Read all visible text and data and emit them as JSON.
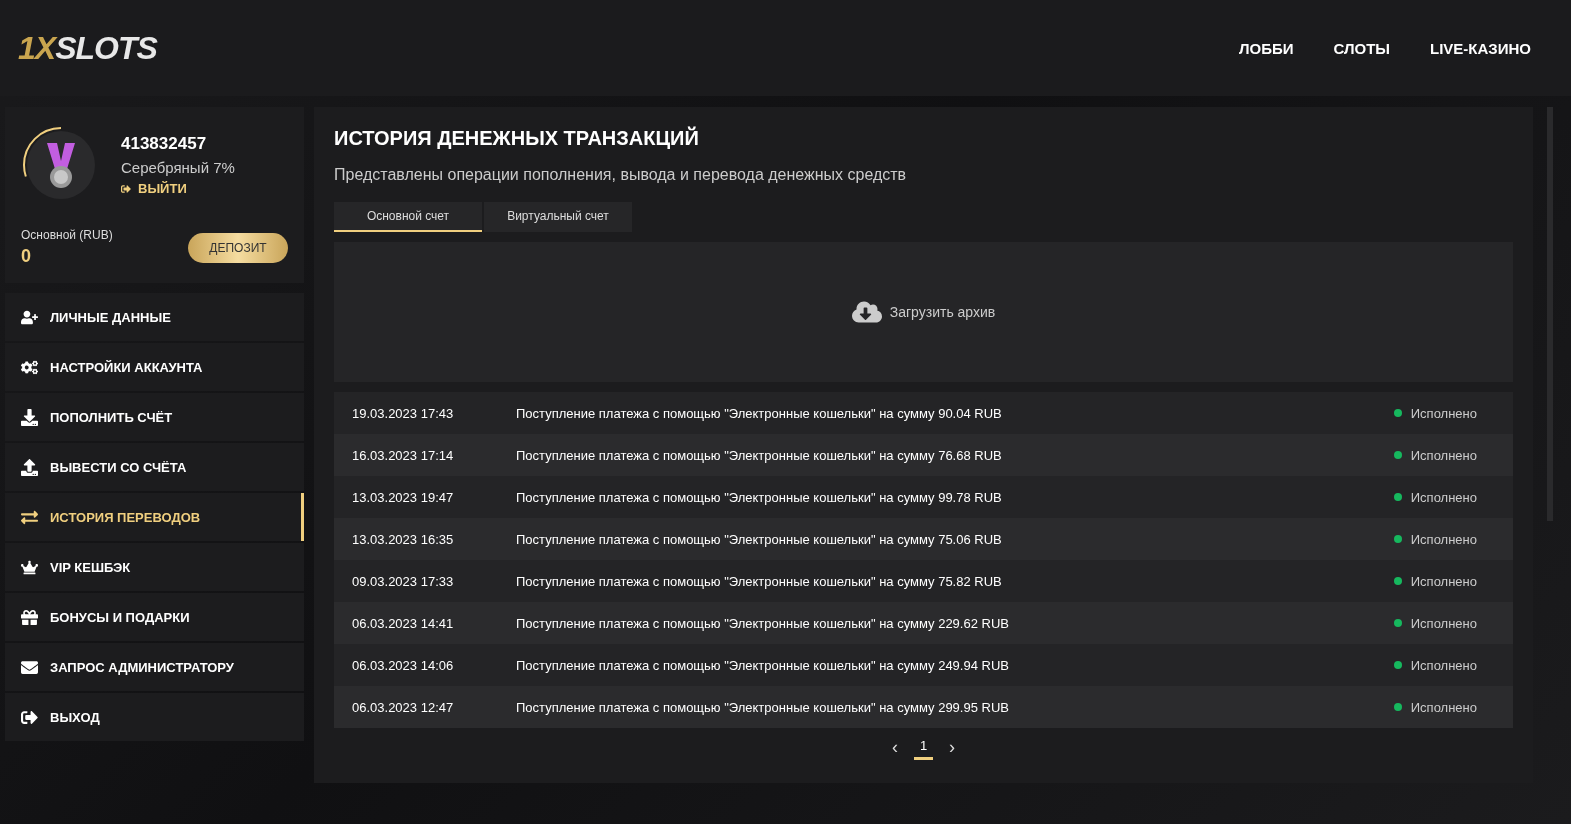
{
  "header": {
    "logo": {
      "accent": "1X",
      "rest": "SLOTS"
    },
    "nav": [
      {
        "label": "ЛОББИ",
        "selected": false
      },
      {
        "label": "СЛОТЫ",
        "selected": false
      },
      {
        "label": "LIVE-КАЗИНО",
        "selected": false
      }
    ]
  },
  "profile": {
    "id": "413832457",
    "status": "Серебряный 7%",
    "level": 0.3,
    "logout": "ВЫЙТИ",
    "balance_label": "Основной (RUB)",
    "balance": "0",
    "deposit": "ДЕПОЗИТ"
  },
  "menu": [
    {
      "kind": "user",
      "label": "ЛИЧНЫЕ ДАННЫЕ",
      "selected": false
    },
    {
      "kind": "gears",
      "label": "НАСТРОЙКИ АККАУНТА",
      "selected": false
    },
    {
      "kind": "download",
      "label": "ПОПОЛНИТЬ СЧЁТ",
      "selected": false
    },
    {
      "kind": "upload",
      "label": "ВЫВЕСТИ СО СЧЁТА",
      "selected": false
    },
    {
      "kind": "transfer",
      "label": "ИСТОРИЯ ПЕРЕВОДОВ",
      "selected": true
    },
    {
      "kind": "crown",
      "label": "VIP КЕШБЭК",
      "selected": false
    },
    {
      "kind": "gift",
      "label": "БОНУСЫ И ПОДАРКИ",
      "selected": false
    },
    {
      "kind": "mail",
      "label": "ЗАПРОС АДМИНИСТРАТОРУ",
      "selected": false
    },
    {
      "kind": "exit",
      "label": "ВЫХОД",
      "selected": false
    }
  ],
  "main": {
    "title": "ИСТОРИЯ ДЕНЕЖНЫХ ТРАНЗАКЦИЙ",
    "subtitle": "Представлены операции пополнения, вывода и перевода денежных средств",
    "tabs": [
      {
        "label": "Основной счет",
        "selected": true
      },
      {
        "label": "Виртуальный счет",
        "selected": false
      }
    ],
    "archive": "Загрузить архив",
    "rows": [
      {
        "date": "19.03.2023 17:43",
        "description": "Поступление платежа с помощью \"Электронные кошельки\" на сумму 90.04 RUB",
        "status": "Исполнено",
        "color": "#16b85e"
      },
      {
        "date": "16.03.2023 17:14",
        "description": "Поступление платежа с помощью \"Электронные кошельки\" на сумму 76.68 RUB",
        "status": "Исполнено",
        "color": "#16b85e"
      },
      {
        "date": "13.03.2023 19:47",
        "description": "Поступление платежа с помощью \"Электронные кошельки\" на сумму 99.78 RUB",
        "status": "Исполнено",
        "color": "#16b85e"
      },
      {
        "date": "13.03.2023 16:35",
        "description": "Поступление платежа с помощью \"Электронные кошельки\" на сумму 75.06 RUB",
        "status": "Исполнено",
        "color": "#16b85e"
      },
      {
        "date": "09.03.2023 17:33",
        "description": "Поступление платежа с помощью \"Электронные кошельки\" на сумму 75.82 RUB",
        "status": "Исполнено",
        "color": "#16b85e"
      },
      {
        "date": "06.03.2023 14:41",
        "description": "Поступление платежа с помощью \"Электронные кошельки\" на сумму 229.62 RUB",
        "status": "Исполнено",
        "color": "#16b85e"
      },
      {
        "date": "06.03.2023 14:06",
        "description": "Поступление платежа с помощью \"Электронные кошельки\" на сумму 249.94 RUB",
        "status": "Исполнено",
        "color": "#16b85e"
      },
      {
        "date": "06.03.2023 12:47",
        "description": "Поступление платежа с помощью \"Электронные кошельки\" на сумму 299.95 RUB",
        "status": "Исполнено",
        "color": "#16b85e"
      }
    ],
    "pagination": {
      "prev": "‹",
      "next": "›",
      "pages": [
        {
          "label": "1",
          "selected": true
        }
      ]
    }
  }
}
